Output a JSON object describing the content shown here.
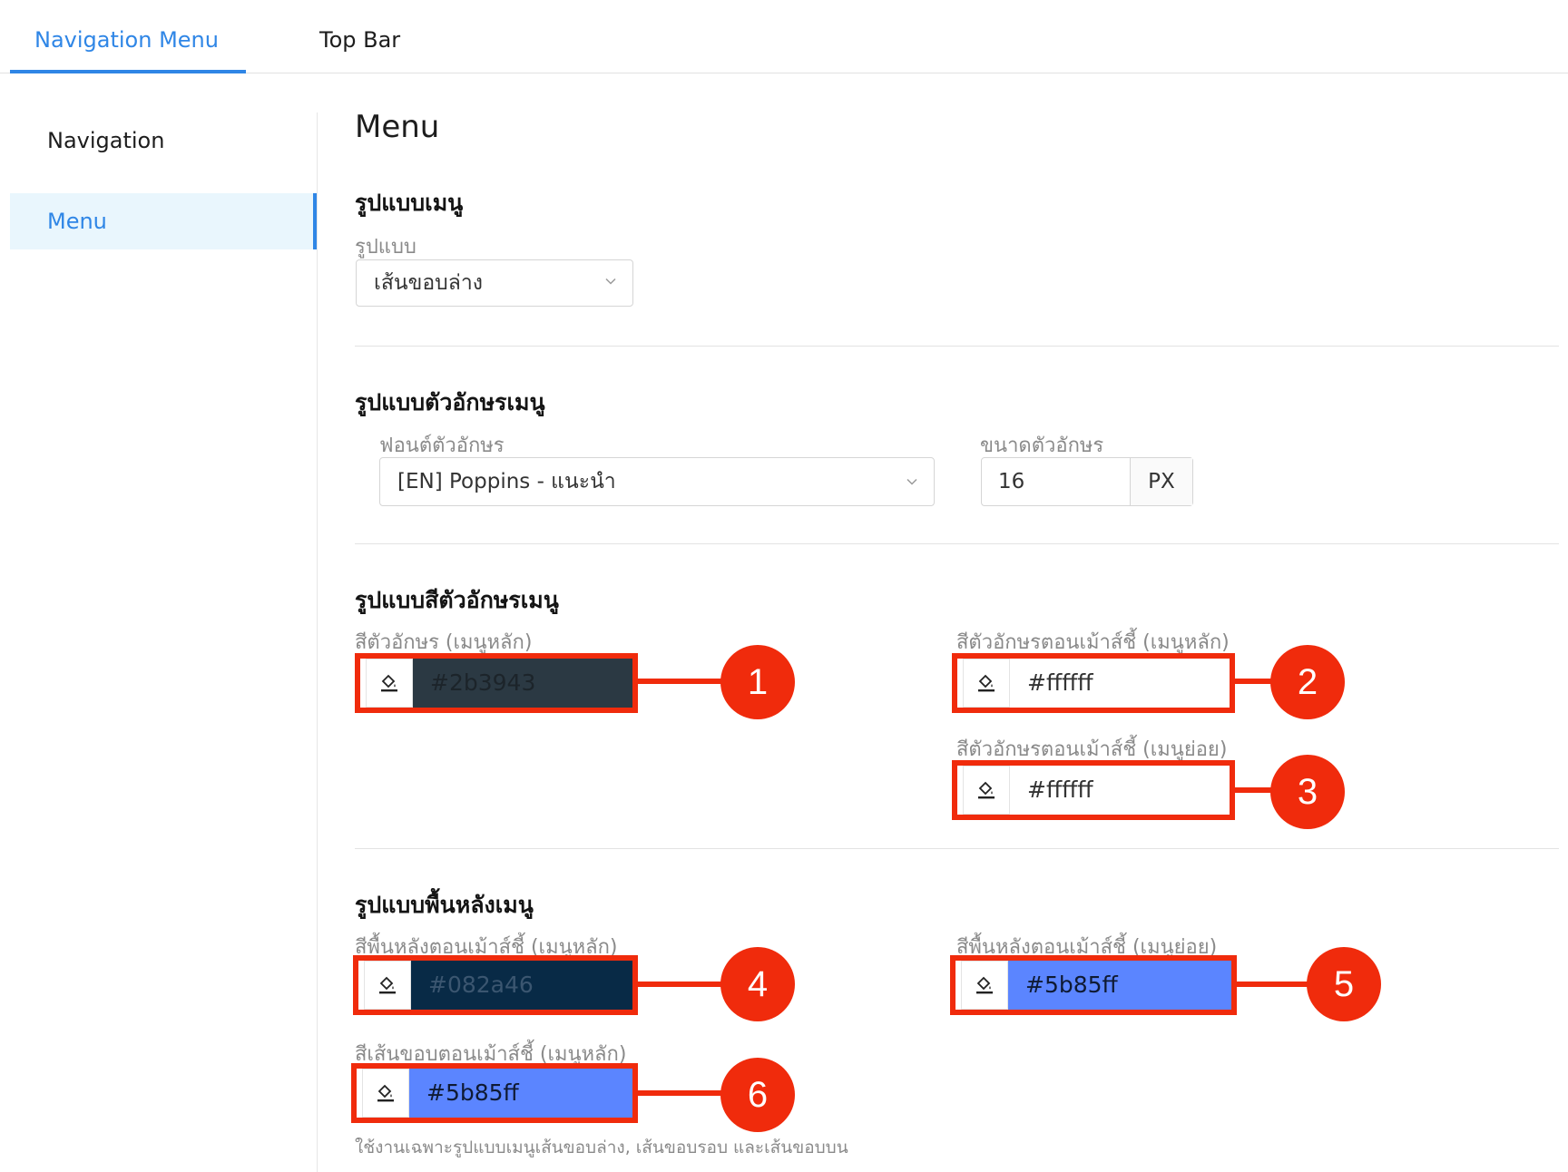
{
  "tabs": {
    "navigation_menu": "Navigation Menu",
    "top_bar": "Top Bar"
  },
  "sidebar": {
    "items": [
      {
        "label": "Navigation"
      },
      {
        "label": "Menu"
      }
    ]
  },
  "page_title": "Menu",
  "menu_style": {
    "title": "รูปแบบเมนู",
    "style_label": "รูปแบบ",
    "style_value": "เส้นขอบล่าง"
  },
  "font_style": {
    "title": "รูปแบบตัวอักษรเมนู",
    "font_label": "ฟอนต์ตัวอักษร",
    "font_value": "[EN] Poppins - แนะนำ",
    "size_label": "ขนาดตัวอักษร",
    "size_value": "16",
    "size_unit": "PX"
  },
  "font_color": {
    "title": "รูปแบบสีตัวอักษรเมนู",
    "main_label": "สีตัวอักษร (เมนูหลัก)",
    "main_value": "#2b3943",
    "hover_main_label": "สีตัวอักษรตอนเม้าส์ชี้ (เมนูหลัก)",
    "hover_main_value": "#ffffff",
    "hover_sub_label": "สีตัวอักษรตอนเม้าส์ชี้ (เมนูย่อย)",
    "hover_sub_value": "#ffffff"
  },
  "background": {
    "title": "รูปแบบพื้นหลังเมนู",
    "hover_main_bg_label": "สีพื้นหลังตอนเม้าส์ชี้ (เมนูหลัก)",
    "hover_main_bg_value": "#082a46",
    "hover_sub_bg_label": "สีพื้นหลังตอนเม้าส์ชี้ (เมนูย่อย)",
    "hover_sub_bg_value": "#5b85ff",
    "hover_border_label": "สีเส้นขอบตอนเม้าส์ชี้ (เมนูหลัก)",
    "hover_border_value": "#5b85ff",
    "note": "ใช้งานเฉพาะรูปแบบเมนูเส้นขอบล่าง, เส้นขอบรอบ และเส้นขอบบน"
  },
  "callouts": [
    "1",
    "2",
    "3",
    "4",
    "5",
    "6"
  ],
  "colors": {
    "accent": "#2f86e6",
    "highlight": "#f02b0c",
    "swatch_text_main": "#2b3943",
    "swatch_hover_main_bg": "#082a46",
    "swatch_blue": "#5b85ff"
  }
}
